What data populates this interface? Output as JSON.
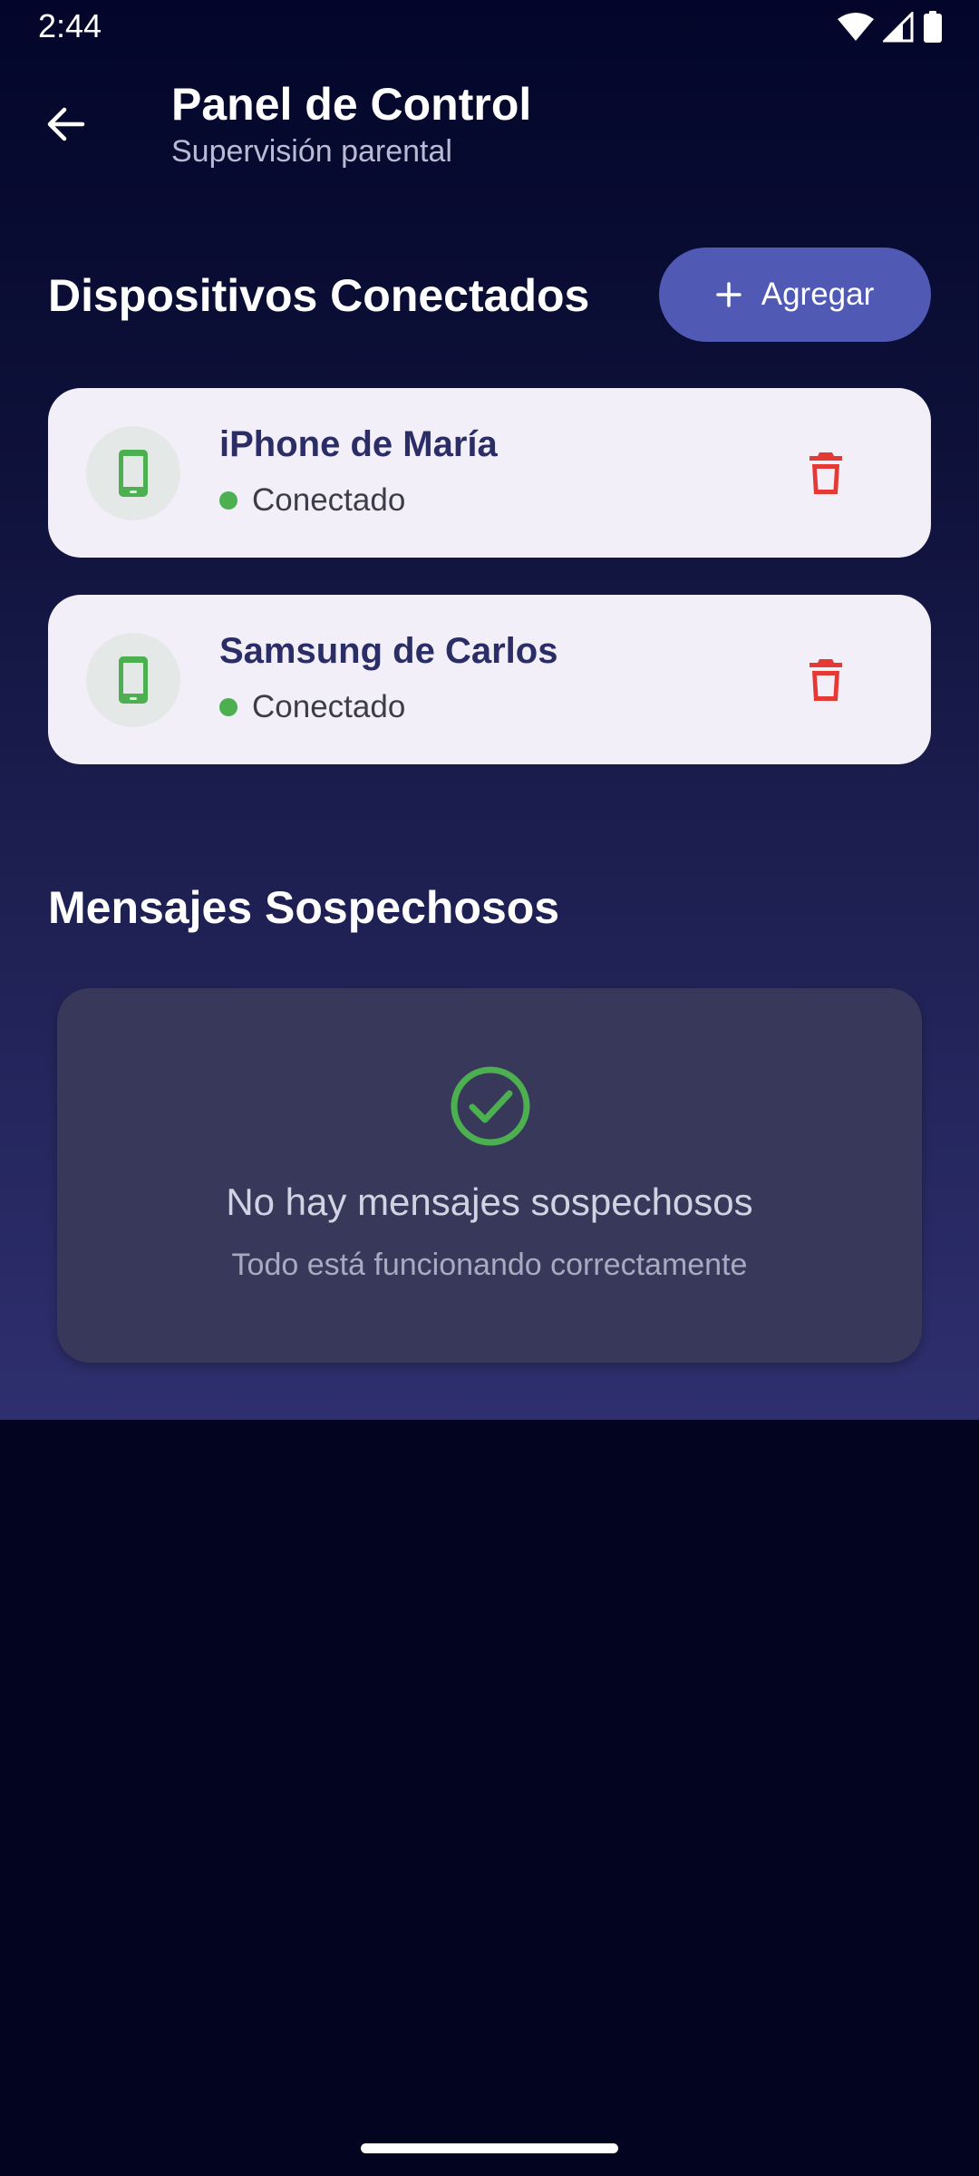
{
  "status_bar": {
    "time": "2:44",
    "icons": [
      "wifi-icon",
      "signal-icon",
      "battery-icon"
    ]
  },
  "app_bar": {
    "title": "Panel de Control",
    "subtitle": "Supervisión parental",
    "back_icon": "arrow-back-icon"
  },
  "devices_section": {
    "title": "Dispositivos Conectados",
    "add_button_label": "Agregar",
    "add_icon": "plus-icon",
    "devices": [
      {
        "name": "iPhone de María",
        "status": "Conectado",
        "icon": "smartphone-icon",
        "action_icon": "trash-icon"
      },
      {
        "name": "Samsung de Carlos",
        "status": "Conectado",
        "icon": "smartphone-icon",
        "action_icon": "trash-icon"
      }
    ]
  },
  "messages_section": {
    "title": "Mensajes Sospechosos",
    "empty_icon": "check-circle-icon",
    "empty_title": "No hay mensajes sospechosos",
    "empty_subtitle": "Todo está funcionando correctamente"
  },
  "colors": {
    "accent_button": "#5059b4",
    "connected_dot": "#4caf50",
    "delete_icon": "#e53935",
    "device_icon": "#4caf50",
    "card_background": "#f3eff8",
    "background_bottom": "#020420"
  }
}
